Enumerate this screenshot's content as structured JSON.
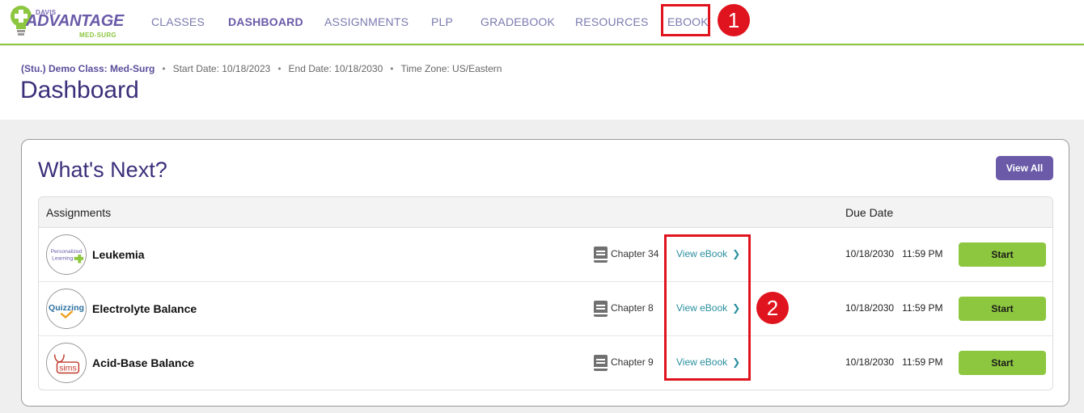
{
  "app": {
    "logo_top": "DAVIS",
    "logo_main": "ADVANTAGE",
    "logo_sub": "MED-SURG"
  },
  "nav": [
    "CLASSES",
    "DASHBOARD",
    "ASSIGNMENTS",
    "PLP",
    "GRADEBOOK",
    "RESOURCES",
    "EBOOK"
  ],
  "annotations": [
    "1",
    "2"
  ],
  "header": {
    "class_name": "(Stu.) Demo Class: Med-Surg",
    "start_date": "Start Date: 10/18/2023",
    "end_date": "End Date: 10/18/2030",
    "time_zone": "Time Zone: US/Eastern",
    "title": "Dashboard"
  },
  "whats_next": {
    "title": "What's Next?",
    "view_all_label": "View All",
    "columns": {
      "assignments": "Assignments",
      "due_date": "Due Date"
    },
    "rows": [
      {
        "badge": "Personalized Learning",
        "name": "Leukemia",
        "chapter": "Chapter 34",
        "ebook_link": "View eBook",
        "due_date": "10/18/2030",
        "due_time": "11:59 PM",
        "action": "Start"
      },
      {
        "badge": "Quizzing",
        "name": "Electrolyte Balance",
        "chapter": "Chapter 8",
        "ebook_link": "View eBook",
        "due_date": "10/18/2030",
        "due_time": "11:59 PM",
        "action": "Start"
      },
      {
        "badge": "sims",
        "name": "Acid-Base Balance",
        "chapter": "Chapter 9",
        "ebook_link": "View eBook",
        "due_date": "10/18/2030",
        "due_time": "11:59 PM",
        "action": "Start"
      }
    ]
  },
  "colors": {
    "brand_purple": "#6a5aa8",
    "brand_green": "#8dc63f",
    "link_teal": "#2a8f9e",
    "annotation_red": "#e0141e"
  }
}
